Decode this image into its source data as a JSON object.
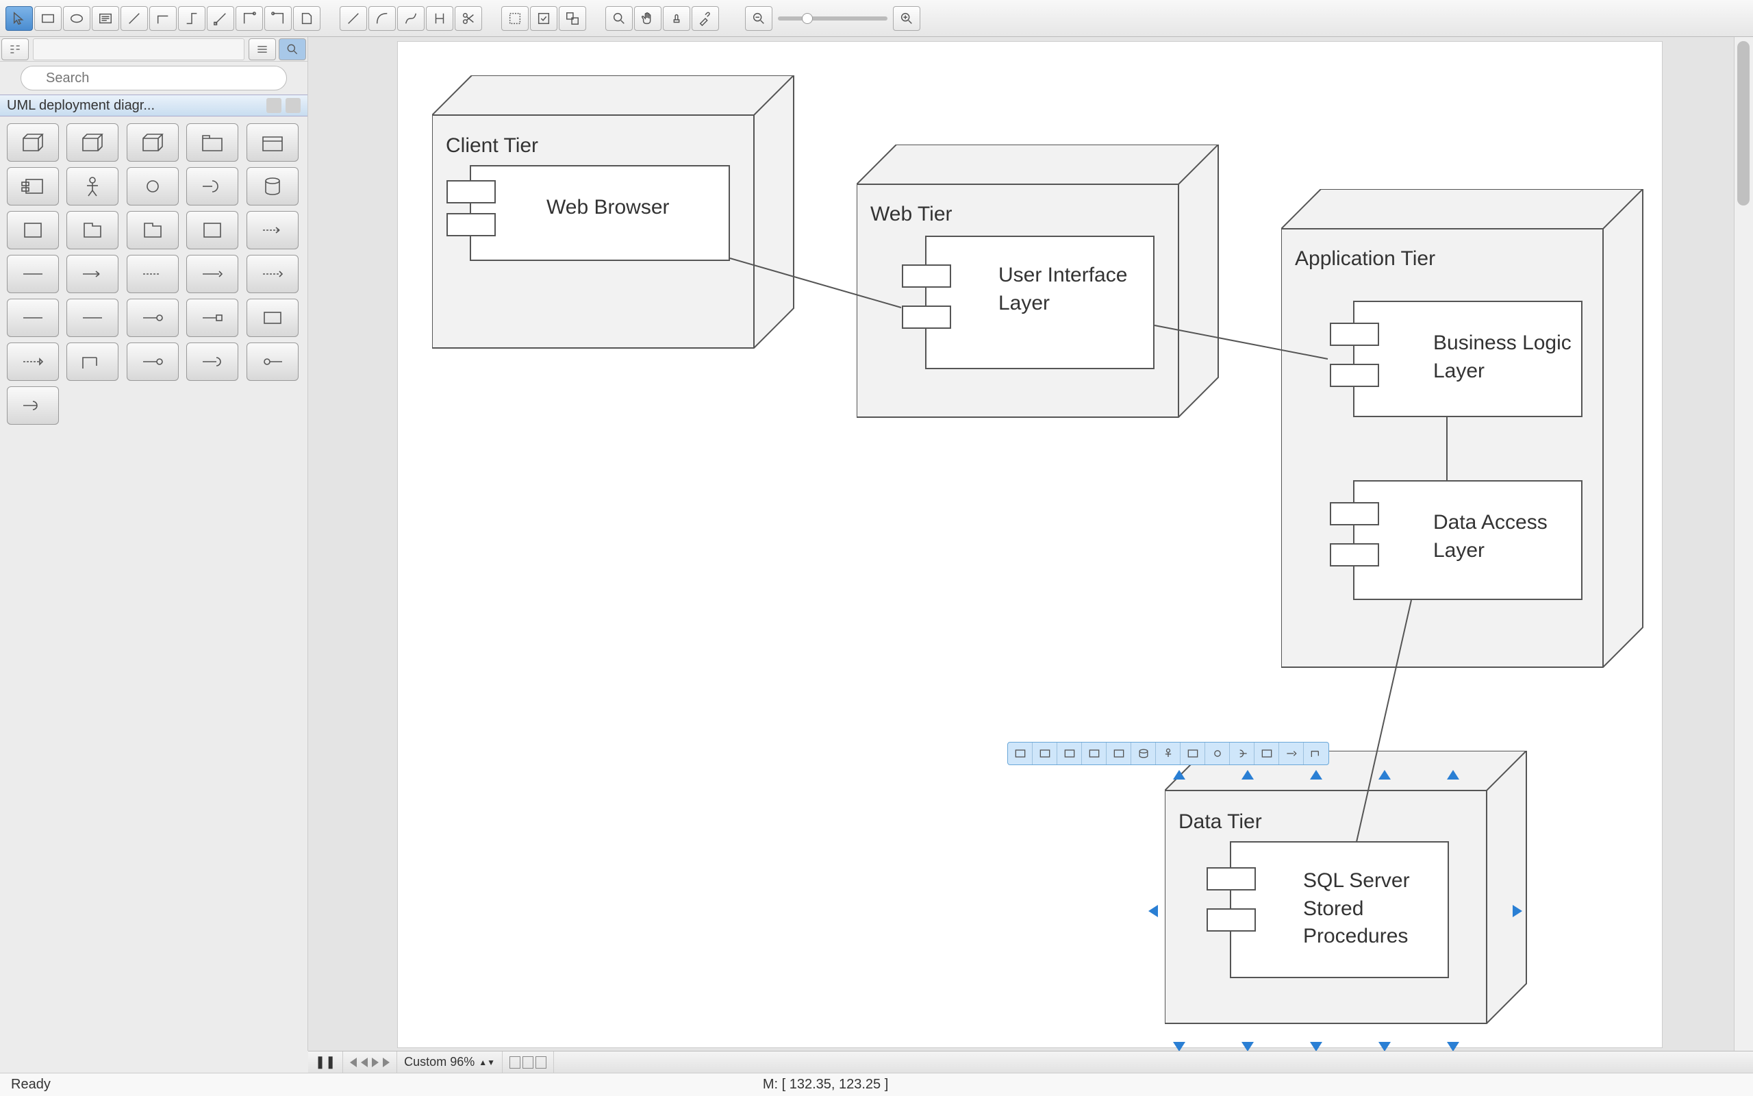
{
  "search": {
    "placeholder": "Search"
  },
  "palette": {
    "title": "UML deployment diagr..."
  },
  "diagram": {
    "nodes": {
      "client": {
        "title": "Client Tier",
        "component": "Web Browser"
      },
      "web": {
        "title": "Web Tier",
        "component": "User Interface Layer"
      },
      "app": {
        "title": "Application Tier",
        "component1": "Business Logic Layer",
        "component2": "Data Access Layer"
      },
      "data": {
        "title": "Data Tier",
        "component": "SQL Server Stored Procedures"
      }
    }
  },
  "footer": {
    "zoom_label": "Custom 96%",
    "status": "Ready",
    "mouse": "M: [ 132.35, 123.25 ]"
  }
}
